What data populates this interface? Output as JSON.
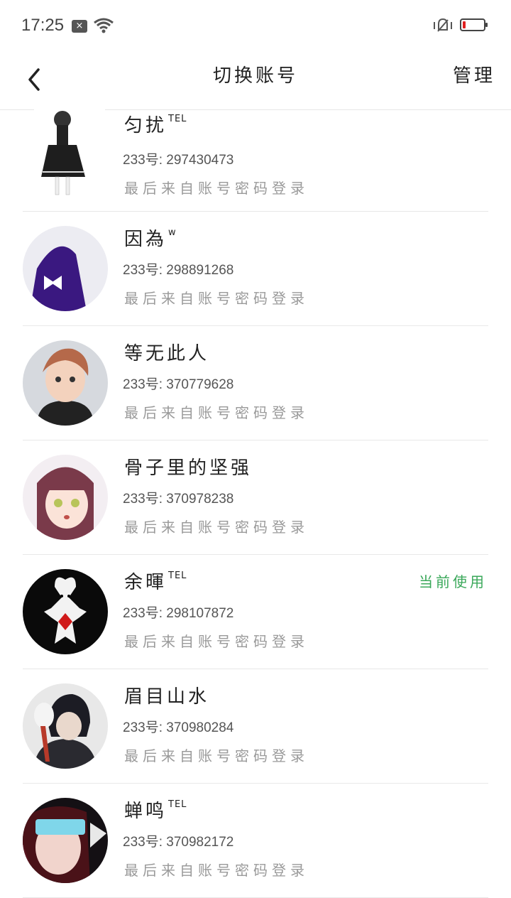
{
  "status_bar": {
    "time": "17:25",
    "notif_badge": "×",
    "battery_level": 0.15,
    "battery_color": "#e02020"
  },
  "header": {
    "title": "切换账号",
    "manage": "管理"
  },
  "accounts": [
    {
      "name": "匀扰",
      "tag": "TEL",
      "uid": "233号: 297430473",
      "last_login": "最后来自账号密码登录",
      "current": ""
    },
    {
      "name": "因為",
      "tag": "w",
      "uid": "233号: 298891268",
      "last_login": "最后来自账号密码登录",
      "current": ""
    },
    {
      "name": "等无此人",
      "tag": "",
      "uid": "233号: 370779628",
      "last_login": "最后来自账号密码登录",
      "current": ""
    },
    {
      "name": "骨子里的坚强",
      "tag": "",
      "uid": "233号: 370978238",
      "last_login": "最后来自账号密码登录",
      "current": ""
    },
    {
      "name": "余暉",
      "tag": "TEL",
      "uid": "233号: 298107872",
      "last_login": "最后来自账号密码登录",
      "current": "当前使用"
    },
    {
      "name": "眉目山水",
      "tag": "",
      "uid": "233号: 370980284",
      "last_login": "最后来自账号密码登录",
      "current": ""
    },
    {
      "name": "蝉鸣",
      "tag": "TEL",
      "uid": "233号: 370982172",
      "last_login": "最后来自账号密码登录",
      "current": ""
    }
  ],
  "colors": {
    "accent_current": "#3aa85a",
    "divider": "#e8e8e8",
    "muted_text": "#9a9a9a"
  },
  "icons": {
    "back": "chevron-left-icon",
    "wifi": "wifi-icon",
    "vibrate": "vibrate-mute-icon",
    "battery": "battery-low-icon"
  }
}
